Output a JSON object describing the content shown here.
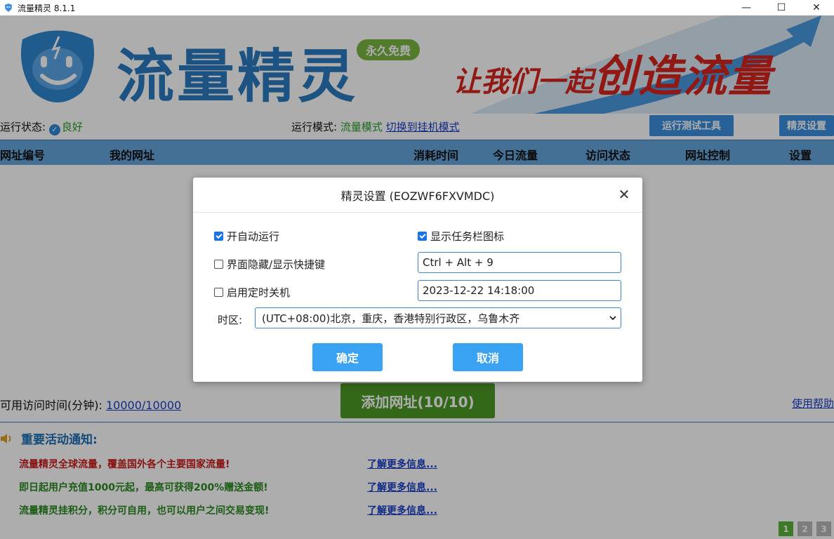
{
  "window": {
    "title": "流量精灵 8.1.1",
    "controls": [
      "—",
      "☐",
      "✕"
    ]
  },
  "banner": {
    "logo_text": "流量精灵",
    "badge": "永久免费",
    "slogan_small": "让我们一起",
    "slogan_big": "创造流量"
  },
  "status": {
    "run_status_label": "运行状态:",
    "run_status_value": "良好",
    "run_mode_label": "运行模式:",
    "run_mode_value": "流量模式",
    "switch_link": "切换到挂机模式",
    "test_tool_button": "运行测试工具",
    "settings_button": "精灵设置"
  },
  "table": {
    "headers": [
      "网址编号",
      "我的网址",
      "消耗时间",
      "今日流量",
      "访问状态",
      "网址控制",
      "设置"
    ]
  },
  "bottom": {
    "available_label": "可用访问时间(分钟):",
    "available_value": "10000/10000",
    "add_button": "添加网址(10/10)",
    "help_link": "使用帮助",
    "notice_title": "重要活动通知:",
    "notices": [
      {
        "text": "流量精灵全球流量，覆盖国外各个主要国家流量!",
        "color": "#cc1b1b",
        "link": "了解更多信息..."
      },
      {
        "text": "即日起用户充值1000元起，最高可获得200%赠送金额!",
        "color": "#2a8a1f",
        "link": "了解更多信息..."
      },
      {
        "text": "流量精灵挂积分，积分可自用，也可以用户之间交易变现!",
        "color": "#2a8a1f",
        "link": "了解更多信息..."
      }
    ],
    "pages": [
      "1",
      "2",
      "3"
    ],
    "active_page": "1"
  },
  "dialog": {
    "title": "精灵设置 (EOZWF6FXVMDC)",
    "close": "✕",
    "auto_run_label": "开自动运行",
    "auto_run_checked": true,
    "taskbar_icon_label": "显示任务栏图标",
    "taskbar_icon_checked": true,
    "hotkey_label": "界面隐藏/显示快捷键",
    "hotkey_checked": false,
    "hotkey_value": "Ctrl + Alt + 9",
    "shutdown_label": "启用定时关机",
    "shutdown_checked": false,
    "shutdown_value": "2023-12-22 14:18:00",
    "timezone_label": "时区:",
    "timezone_value": "(UTC+08:00)北京，重庆，香港特别行政区，乌鲁木齐",
    "ok_button": "确定",
    "cancel_button": "取消"
  }
}
